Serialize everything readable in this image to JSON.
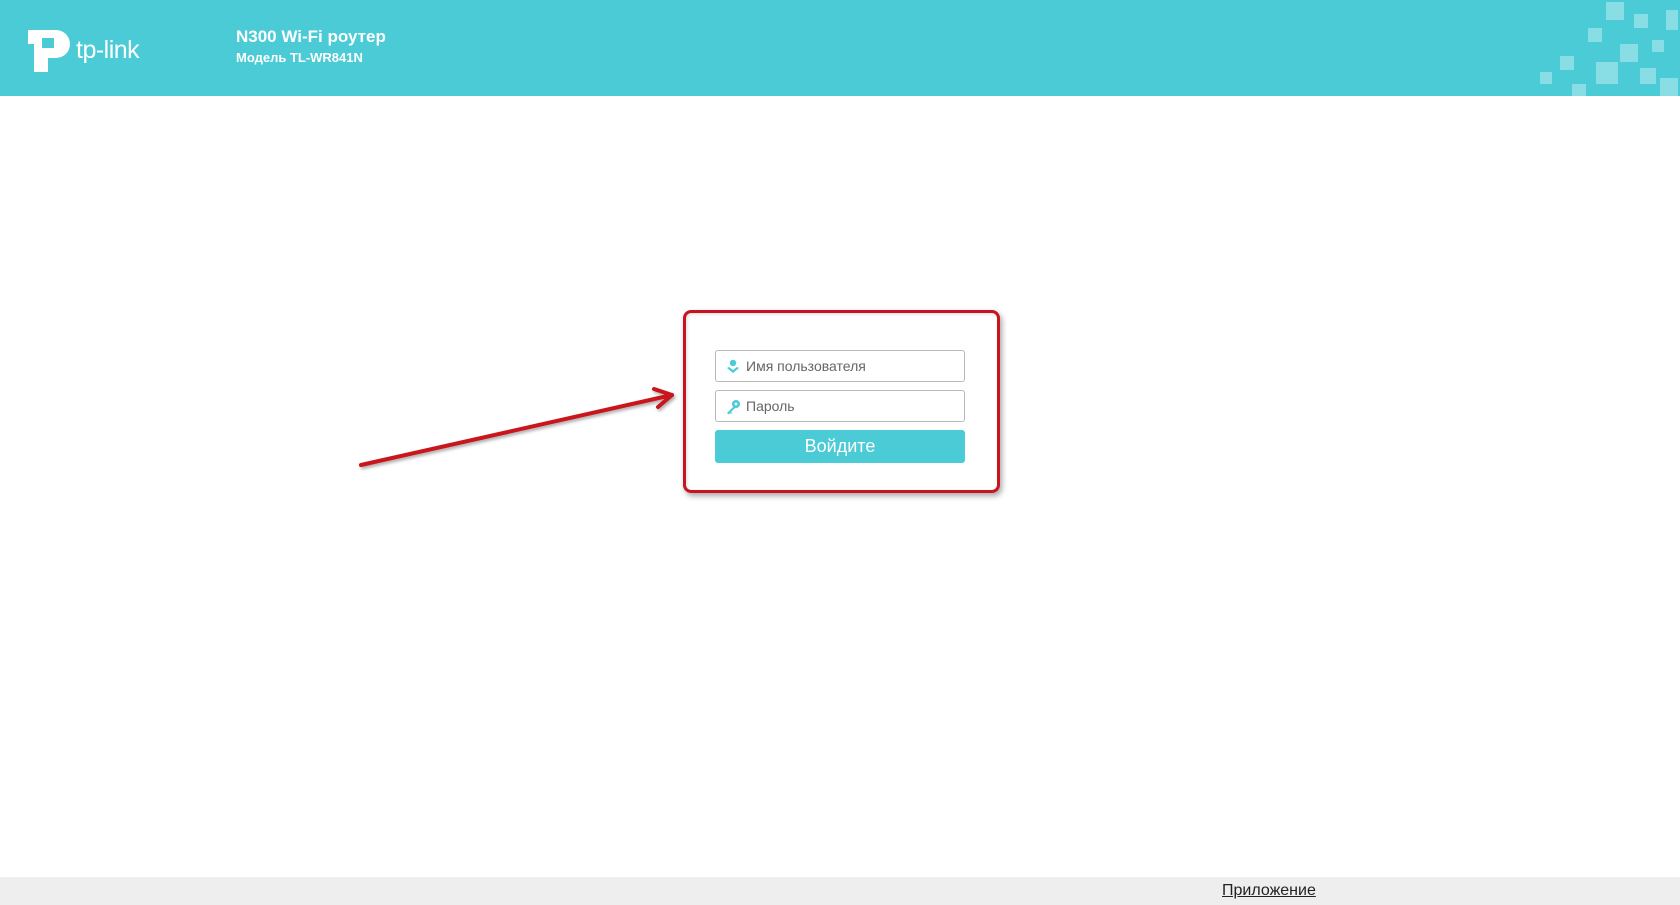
{
  "header": {
    "brand": "tp-link",
    "product_title": "N300 Wi-Fi роутер",
    "model_title": "Модель TL-WR841N"
  },
  "login": {
    "username_placeholder": "Имя пользователя",
    "password_placeholder": "Пароль",
    "submit_label": "Войдите"
  },
  "footer": {
    "app_link": "Приложение"
  },
  "colors": {
    "brand_teal": "#4acbd6",
    "annotation_red": "#c8141e",
    "footer_bg": "#eeeeee"
  },
  "icons": {
    "logo": "tp-link-logo-icon",
    "username": "user-icon",
    "password": "key-icon"
  }
}
